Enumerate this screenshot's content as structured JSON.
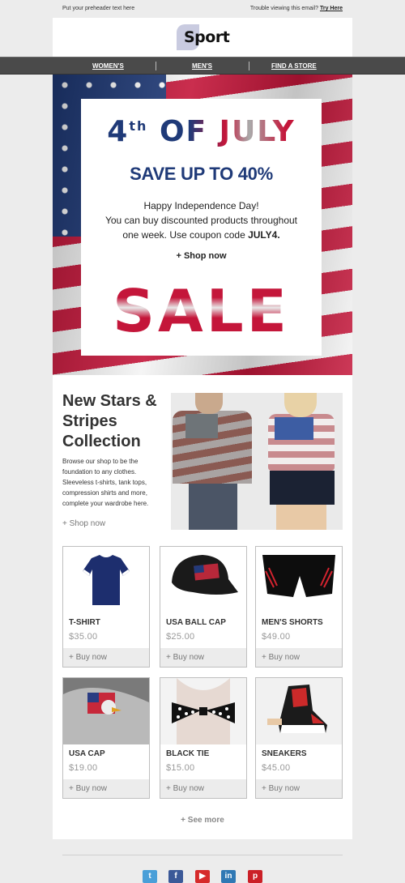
{
  "preheader": {
    "text": "Put your preheader text here",
    "trouble": "Trouble viewing this email?",
    "try_here": "Try Here"
  },
  "logo": {
    "text": "Sport"
  },
  "nav": {
    "items": [
      "WOMEN'S",
      "MEN'S",
      "FIND A STORE"
    ]
  },
  "hero": {
    "title_main": "4",
    "title_sup": "th",
    "title_rest": " OF JULY",
    "save": "SAVE UP TO 40%",
    "desc_line1": "Happy Independence Day!",
    "desc_line2": "You can buy discounted products throughout one week. Use coupon code ",
    "coupon": "JULY4.",
    "shop": "+ Shop now",
    "sale": "SALE"
  },
  "collection": {
    "title": "New Stars & Stripes Collection",
    "text": "Browse our shop to be the foundation to any clothes. Sleeveless t-shirts, tank tops, compression shirts and more, complete your wardrobe here.",
    "shop": "+ Shop now"
  },
  "products": [
    {
      "name": "T-SHIRT",
      "price": "$35.00",
      "buy": "+ Buy now"
    },
    {
      "name": "USA BALL CAP",
      "price": "$25.00",
      "buy": "+ Buy now"
    },
    {
      "name": "MEN'S SHORTS",
      "price": "$49.00",
      "buy": "+ Buy now"
    },
    {
      "name": "USA CAP",
      "price": "$19.00",
      "buy": "+ Buy now"
    },
    {
      "name": "BLACK TIE",
      "price": "$15.00",
      "buy": "+ Buy now"
    },
    {
      "name": "SNEAKERS",
      "price": "$45.00",
      "buy": "+ Buy now"
    }
  ],
  "see_more": "+ See more",
  "social": [
    {
      "icon": "twitter-icon",
      "glyph": "t",
      "color": "#4a9fd8"
    },
    {
      "icon": "facebook-icon",
      "glyph": "f",
      "color": "#3b5998"
    },
    {
      "icon": "youtube-icon",
      "glyph": "▶",
      "color": "#d62a2a"
    },
    {
      "icon": "linkedin-icon",
      "glyph": "in",
      "color": "#2f78b4"
    },
    {
      "icon": "pinterest-icon",
      "glyph": "p",
      "color": "#cb2027"
    }
  ]
}
